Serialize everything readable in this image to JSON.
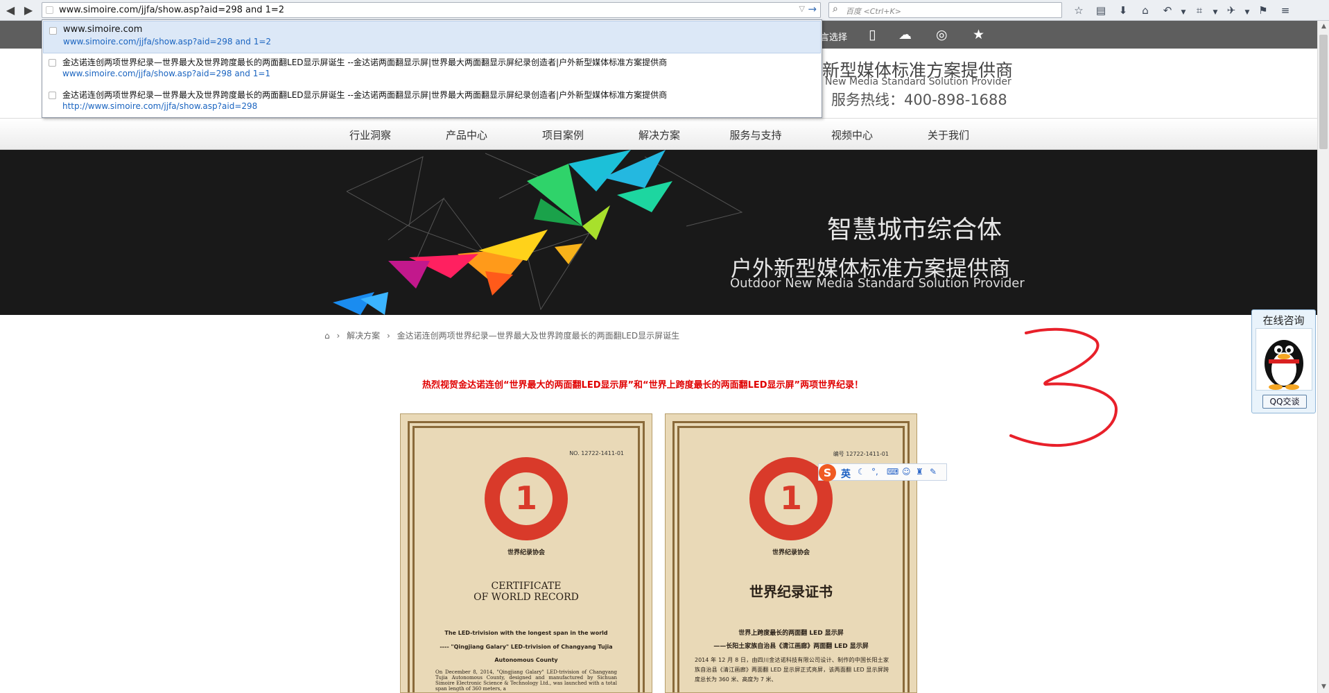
{
  "browser": {
    "url": "www.simoire.com/jjfa/show.asp?aid=298 and 1=2",
    "search_placeholder": "百度 <Ctrl+K>",
    "dropdown": [
      {
        "title": "www.simoire.com",
        "url": "www.simoire.com/jjfa/show.asp?aid=298 and 1=2"
      },
      {
        "title": "金达诺连创两项世界纪录—世界最大及世界跨度最长的两面翻LED显示屏诞生 --金达诺两面翻显示屏|世界最大两面翻显示屏纪录创造者|户外新型媒体标准方案提供商",
        "url": "www.simoire.com/jjfa/show.asp?aid=298 and 1=1"
      },
      {
        "title": "金达诺连创两项世界纪录—世界最大及世界跨度最长的两面翻LED显示屏诞生 --金达诺两面翻显示屏|世界最大两面翻显示屏纪录创造者|户外新型媒体标准方案提供商",
        "url": "http://www.simoire.com/jjfa/show.asp?aid=298"
      }
    ]
  },
  "site": {
    "lang_select": "言选择",
    "slogan": "新型媒体标准方案提供商",
    "slogan_en": "New Media Standard Solution Provider",
    "hotline": "服务热线：400-898-1688",
    "nav": [
      "行业洞察",
      "产品中心",
      "项目案例",
      "解决方案",
      "服务与支持",
      "视频中心",
      "关于我们"
    ],
    "banner": {
      "line1": "智慧城市综合体",
      "line2": "户外新型媒体标准方案提供商",
      "line3": "Outdoor New Media Standard Solution Provider"
    },
    "breadcrumb": {
      "section": "解决方案",
      "current": "金达诺连创两项世界纪录—世界最大及世界跨度最长的两面翻LED显示屏诞生"
    },
    "headline": "热烈视贺金达诺连创“世界最大的两面翻LED显示屏”和“世界上跨度最长的两面翻LED显示屏”两项世界纪录！"
  },
  "certificates": {
    "left": {
      "no": "NO. 12722-1411-01",
      "assoc": "世界纪录协会",
      "title_en_1": "CERTIFICATE",
      "title_en_2": "OF WORLD RECORD",
      "line1": "The LED-trivision with the longest span in the world",
      "line2": "---- \"Qingjiang Galary\" LED-trivision of Changyang Tujia",
      "line3": "Autonomous County",
      "body": "On December 8, 2014, \"Qingjiang Galary\" LED-trivision of Changyang Tujia Autonomous County, designed and manufactured by Sichuan Simoire Electronic Science & Technology Ltd., was launched with a total span length of 360 meters, a"
    },
    "right": {
      "no": "编号 12722-1411-01",
      "assoc": "世界纪录协会",
      "title_cn": "世界纪录证书",
      "line1": "世界上跨度最长的两面翻 LED 显示屏",
      "line2": "——长阳土家族自治县《清江画廊》两面翻 LED 显示屏",
      "body": "2014 年 12 月 8 日，由四川金达诺科技有限公司设计、制作的中国长阳土家族自治县《清江画廊》两面翻 LED 显示屏正式亮屏，该两面翻 LED 显示屏跨度总长为 360 米、高度为 7 米、"
    }
  },
  "qq_widget": {
    "title": "在线咨询",
    "button": "QQ交谈"
  },
  "ime": {
    "logo": "S",
    "lang": "英"
  },
  "annotation": {
    "text": "3",
    "color": "#e8202a"
  }
}
